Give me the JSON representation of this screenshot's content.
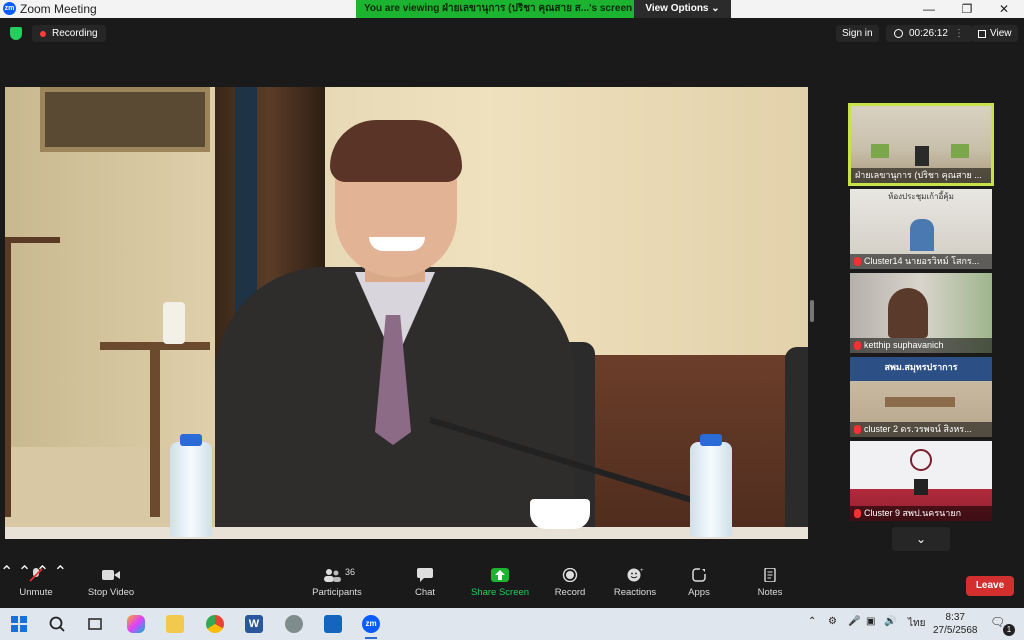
{
  "window": {
    "title": "Zoom Meeting",
    "app_icon": "zm",
    "controls": [
      "minimize-icon",
      "restore-icon",
      "close-icon"
    ]
  },
  "share_banner": {
    "text": "You are viewing ฝ่ายเลขานุการ (ปริชา  คุณสาย ส...'s screen",
    "view_options": "View Options ⌄"
  },
  "topbar": {
    "recording_label": "Recording",
    "sign_in": "Sign in",
    "timer": "00:26:12",
    "view_label": "View"
  },
  "participants_panel": {
    "thumbnails": [
      {
        "name": "ฝ่ายเลขานุการ (ปริชา  คุณสาย ...",
        "muted": false,
        "active": true
      },
      {
        "name": "Cluster14 นายอรวิหม์ โสกร...",
        "muted": true,
        "active": false
      },
      {
        "name": "ketthip suphavanich",
        "muted": true,
        "active": false
      },
      {
        "name": "cluster 2 ดร.วรพจน์ สิงหร...",
        "muted": true,
        "active": false
      },
      {
        "name": "Cluster 9 สพป.นครนายก",
        "muted": true,
        "active": false
      }
    ],
    "thumb2_header": "ห้องประชุมเก้าอี้คุ้ม",
    "thumb4_header": "สพม.สมุทรปราการ",
    "more_icon": "chevron-down-icon"
  },
  "toolbar": {
    "unmute": "Unmute",
    "stop_video": "Stop Video",
    "participants_count": "36",
    "participants": "Participants",
    "chat": "Chat",
    "share_screen": "Share Screen",
    "record": "Record",
    "reactions": "Reactions",
    "apps": "Apps",
    "notes": "Notes",
    "leave": "Leave"
  },
  "taskbar": {
    "language": "ไทย",
    "time": "8:37",
    "date": "27/5/2568",
    "notification_count": "1"
  },
  "colors": {
    "share_green": "#1bb32f",
    "leave_red": "#d32f2f",
    "active_thumb": "#c8e34a",
    "zoom_blue": "#0b5cff"
  }
}
